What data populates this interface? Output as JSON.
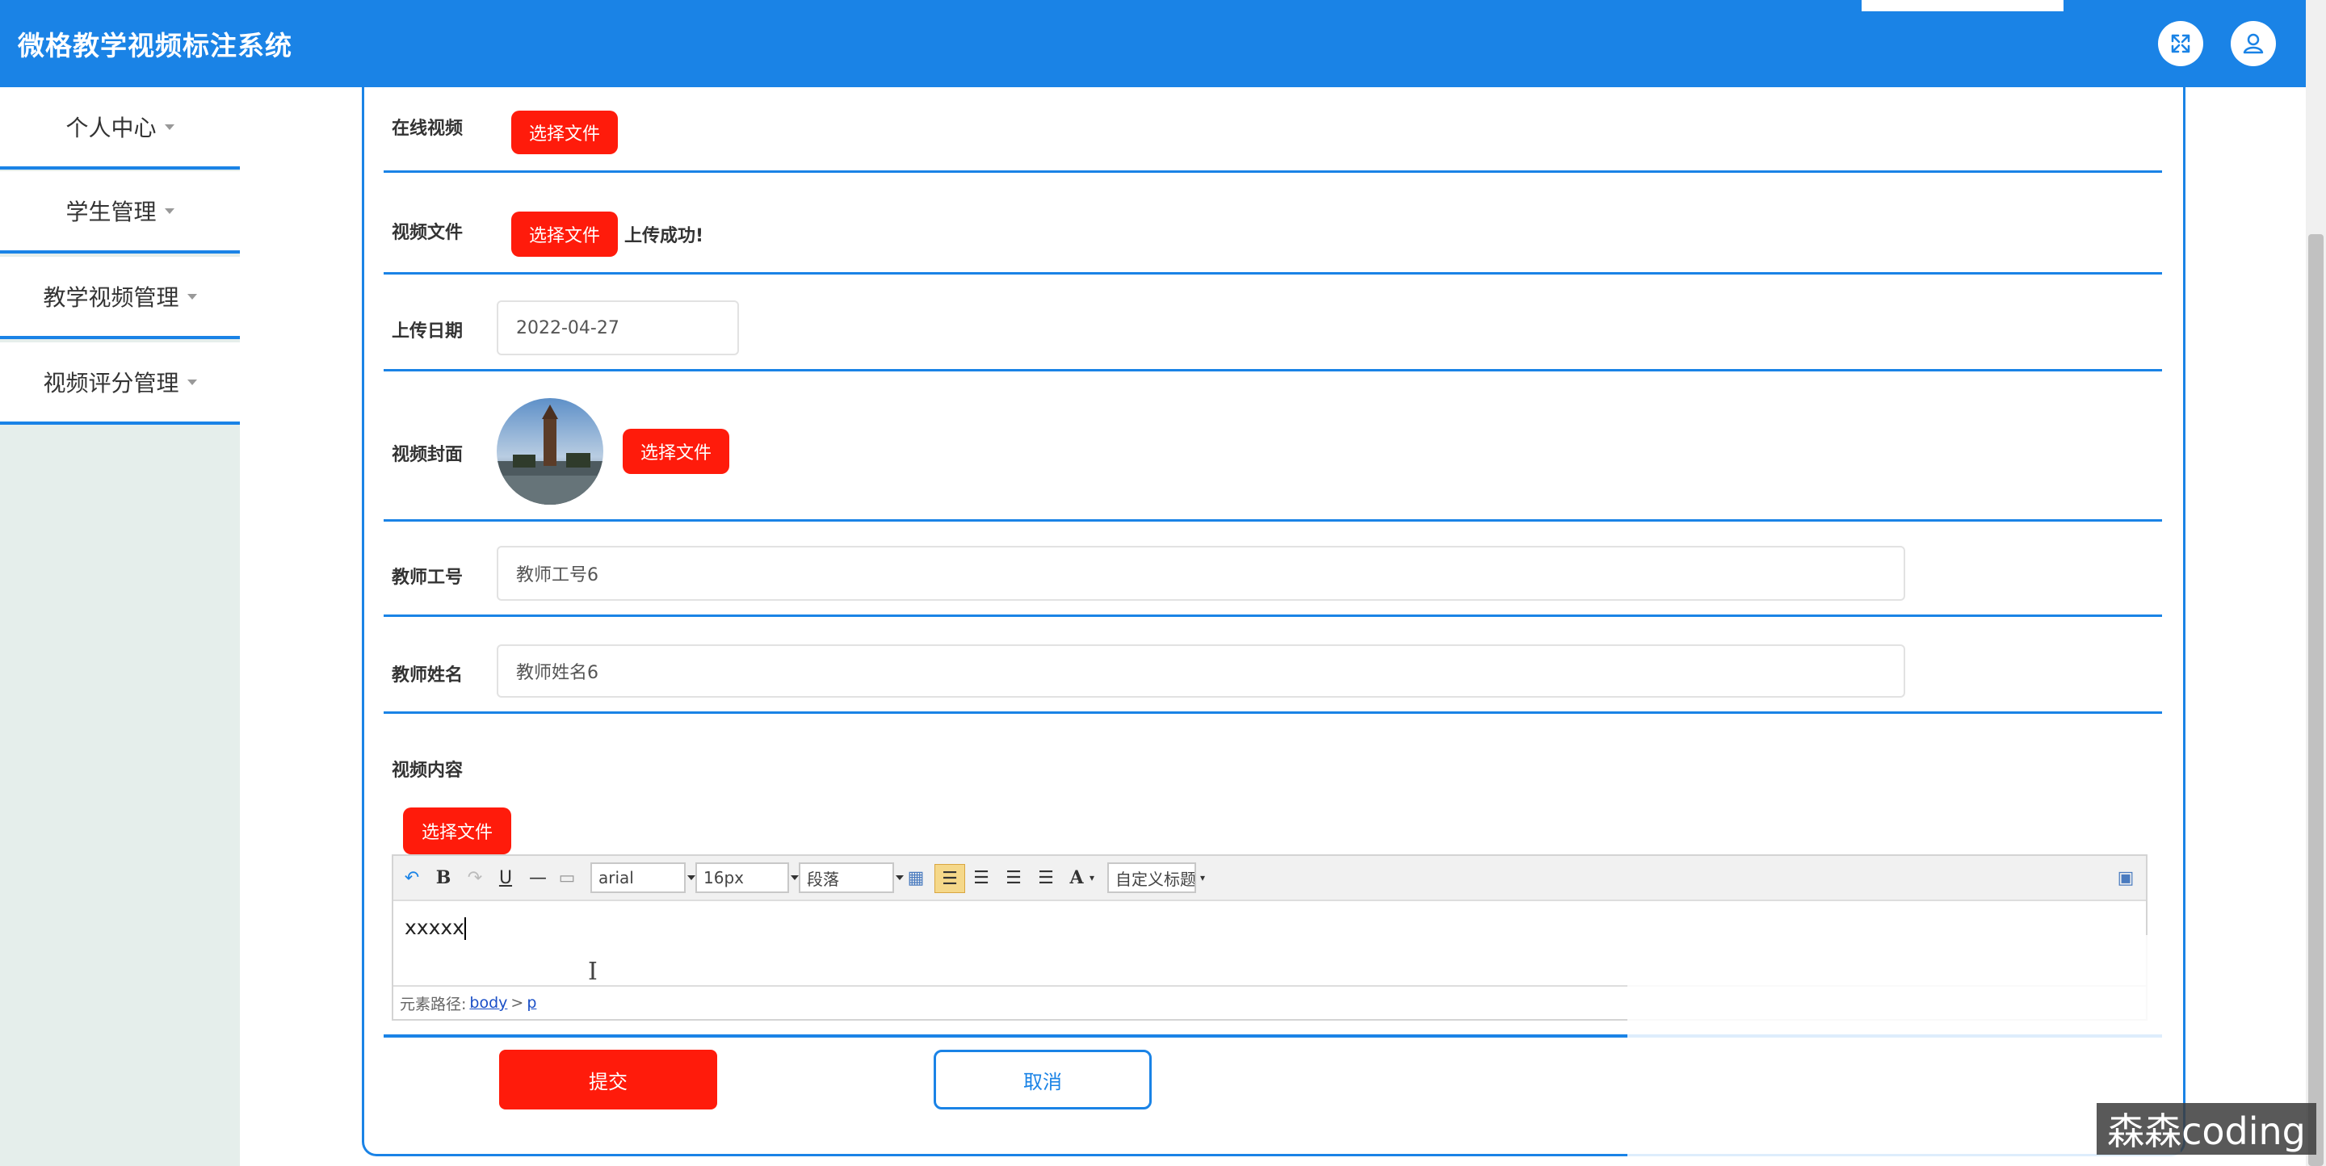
{
  "app": {
    "title": "微格教学视频标注系统"
  },
  "header": {
    "fullscreen_icon": "expand-icon",
    "user_icon": "user-icon"
  },
  "sidebar": {
    "items": [
      {
        "label": "个人中心"
      },
      {
        "label": "学生管理"
      },
      {
        "label": "教学视频管理"
      },
      {
        "label": "视频评分管理"
      }
    ]
  },
  "form": {
    "online_video": {
      "label": "在线视频",
      "button": "选择文件"
    },
    "video_file": {
      "label": "视频文件",
      "button": "选择文件",
      "status": "上传成功!"
    },
    "upload_date": {
      "label": "上传日期",
      "value": "2022-04-27"
    },
    "cover": {
      "label": "视频封面",
      "button": "选择文件"
    },
    "teacher_id": {
      "label": "教师工号",
      "value": "教师工号6"
    },
    "teacher_name": {
      "label": "教师姓名",
      "value": "教师姓名6"
    },
    "content": {
      "label": "视频内容",
      "button": "选择文件"
    }
  },
  "editor": {
    "font_family": "arial",
    "font_size": "16px",
    "paragraph": "段落",
    "custom_title": "自定义标题",
    "bold": "B",
    "underline": "U",
    "font_color": "A",
    "body_text": "xxxxx",
    "path_label": "元素路径:",
    "path_body": "body",
    "path_sep": ">",
    "path_p": "p"
  },
  "actions": {
    "submit": "提交",
    "cancel": "取消"
  },
  "watermark": "森森coding",
  "colors": {
    "primary": "#1a83e6",
    "danger": "#ff1b0b",
    "sidebar_bg": "#e5eeeb"
  }
}
